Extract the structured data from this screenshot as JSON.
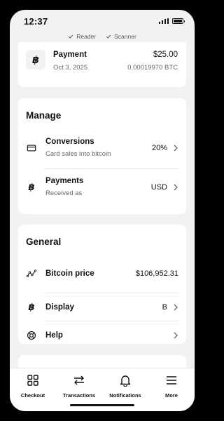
{
  "status_bar": {
    "time": "12:37"
  },
  "device_status": [
    {
      "label": "Reader",
      "icon": "check-icon"
    },
    {
      "label": "Scanner",
      "icon": "check-icon"
    }
  ],
  "payment": {
    "icon_glyph": "฿",
    "title": "Payment",
    "date": "Oct 3, 2025",
    "amount": "$25.00",
    "btc_amount": "0.00019970 BTC"
  },
  "manage": {
    "title": "Manage",
    "rows": [
      {
        "icon": "card-icon",
        "title": "Conversions",
        "subtitle": "Card sales into bitcoin",
        "value": "20%"
      },
      {
        "icon": "bitcoin-icon",
        "icon_glyph": "฿",
        "title": "Payments",
        "subtitle": "Received as",
        "value": "USD"
      }
    ]
  },
  "general": {
    "title": "General",
    "rows": [
      {
        "icon": "chart-line-icon",
        "title": "Bitcoin price",
        "value": "$106,952.31"
      },
      {
        "icon": "bitcoin-icon",
        "icon_glyph": "฿",
        "title": "Display",
        "value": "B"
      },
      {
        "icon": "help-icon",
        "title": "Help",
        "value": ""
      }
    ]
  },
  "tabs": [
    {
      "label": "Checkout",
      "icon": "grid-icon"
    },
    {
      "label": "Transactions",
      "icon": "arrows-swap-icon"
    },
    {
      "label": "Notifications",
      "icon": "bell-icon"
    },
    {
      "label": "More",
      "icon": "menu-icon"
    }
  ],
  "colors": {
    "background": "#f2f2f2",
    "card": "#ffffff",
    "text": "#111111",
    "muted": "#666666"
  }
}
